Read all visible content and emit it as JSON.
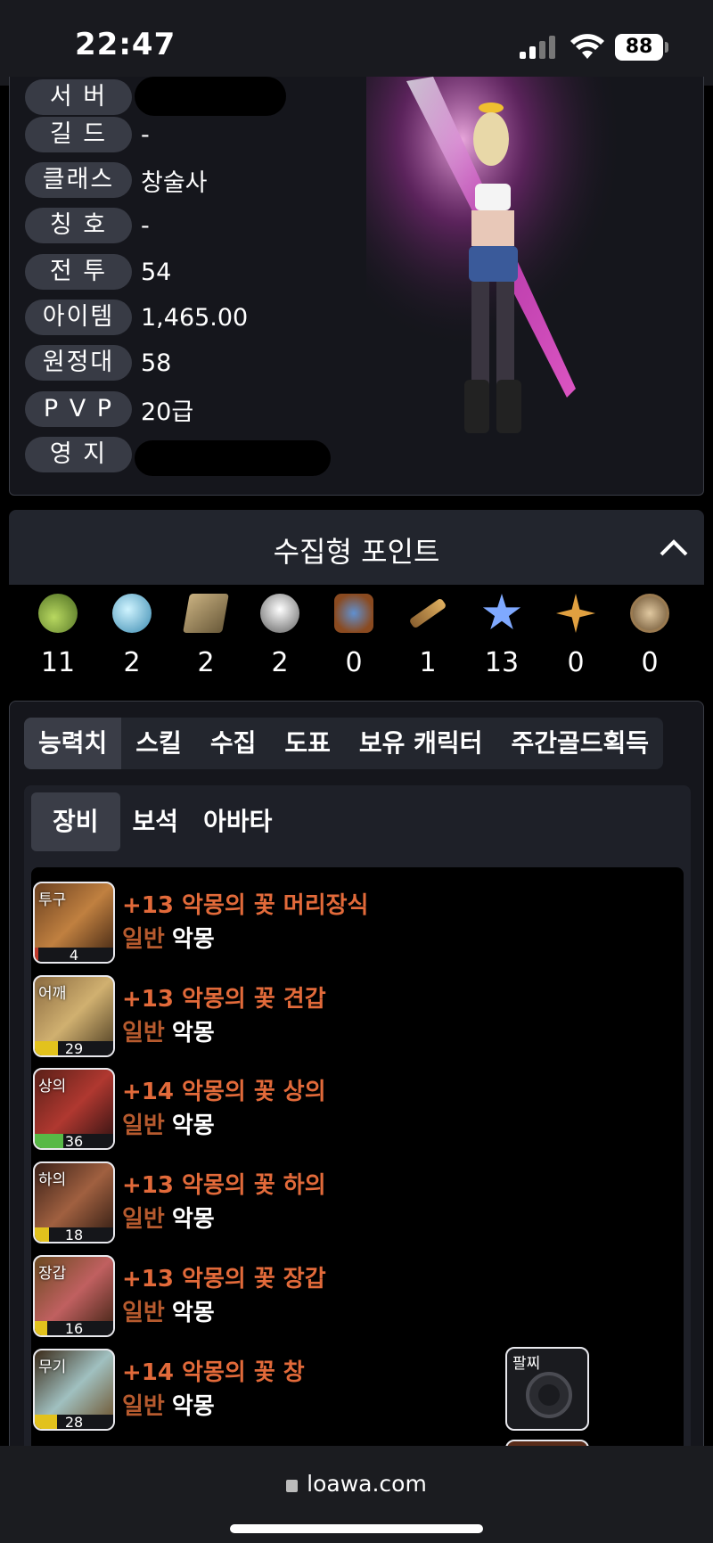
{
  "status": {
    "time": "22:47",
    "battery": "88"
  },
  "profile": {
    "rows": [
      {
        "label": "서 버",
        "value": ""
      },
      {
        "label": "길 드",
        "value": "-"
      },
      {
        "label": "클래스",
        "value": "창술사"
      },
      {
        "label": "칭 호",
        "value": "-"
      },
      {
        "label": "전 투",
        "value": "54"
      },
      {
        "label": "아이템",
        "value": "1,465.00"
      },
      {
        "label": "원정대",
        "value": "58"
      },
      {
        "label": "P V P",
        "value": "20급"
      },
      {
        "label": "영 지",
        "value": ""
      }
    ]
  },
  "collect": {
    "title": "수집형 포인트",
    "items": [
      {
        "icon": "island-heart-icon",
        "count": "11",
        "color": "#9fc04a"
      },
      {
        "icon": "orb-icon",
        "count": "2",
        "color": "#7fc9d6"
      },
      {
        "icon": "map-icon",
        "count": "2",
        "color": "#b09a6a"
      },
      {
        "icon": "giant-heart-icon",
        "count": "2",
        "color": "#d8d8d8"
      },
      {
        "icon": "ignea-token-icon",
        "count": "0",
        "color": "#c4743a"
      },
      {
        "icon": "telescope-icon",
        "count": "1",
        "color": "#c8a060"
      },
      {
        "icon": "star-leaf-icon",
        "count": "13",
        "color": "#7fa9ff"
      },
      {
        "icon": "compass-star-icon",
        "count": "0",
        "color": "#e0a040"
      },
      {
        "icon": "coin-icon",
        "count": "0",
        "color": "#b59a70"
      }
    ]
  },
  "tabs": [
    "능력치",
    "스킬",
    "수집",
    "도표",
    "보유 캐릭터",
    "주간골드획득"
  ],
  "subtabs": [
    "장비",
    "보석",
    "아바타"
  ],
  "equipment": [
    {
      "slot": "투구",
      "quality": "4",
      "quality_pct": 4,
      "bar_color": "#c0392b",
      "name": "+13 악몽의 꽃 머리장식",
      "grade": "일반",
      "set": "악몽"
    },
    {
      "slot": "어깨",
      "quality": "29",
      "quality_pct": 29,
      "bar_color": "#e2c21d",
      "name": "+13 악몽의 꽃 견갑",
      "grade": "일반",
      "set": "악몽"
    },
    {
      "slot": "상의",
      "quality": "36",
      "quality_pct": 36,
      "bar_color": "#58b946",
      "name": "+14 악몽의 꽃 상의",
      "grade": "일반",
      "set": "악몽"
    },
    {
      "slot": "하의",
      "quality": "18",
      "quality_pct": 18,
      "bar_color": "#e2c21d",
      "name": "+13 악몽의 꽃 하의",
      "grade": "일반",
      "set": "악몽"
    },
    {
      "slot": "장갑",
      "quality": "16",
      "quality_pct": 16,
      "bar_color": "#e2c21d",
      "name": "+13 악몽의 꽃 장갑",
      "grade": "일반",
      "set": "악몽"
    },
    {
      "slot": "무기",
      "quality": "28",
      "quality_pct": 28,
      "bar_color": "#e2c21d",
      "name": "+14 악몽의 꽃 창",
      "grade": "일반",
      "set": "악몽"
    }
  ],
  "accessory": {
    "label": "팔찌"
  },
  "browser": {
    "url": "loawa.com"
  }
}
